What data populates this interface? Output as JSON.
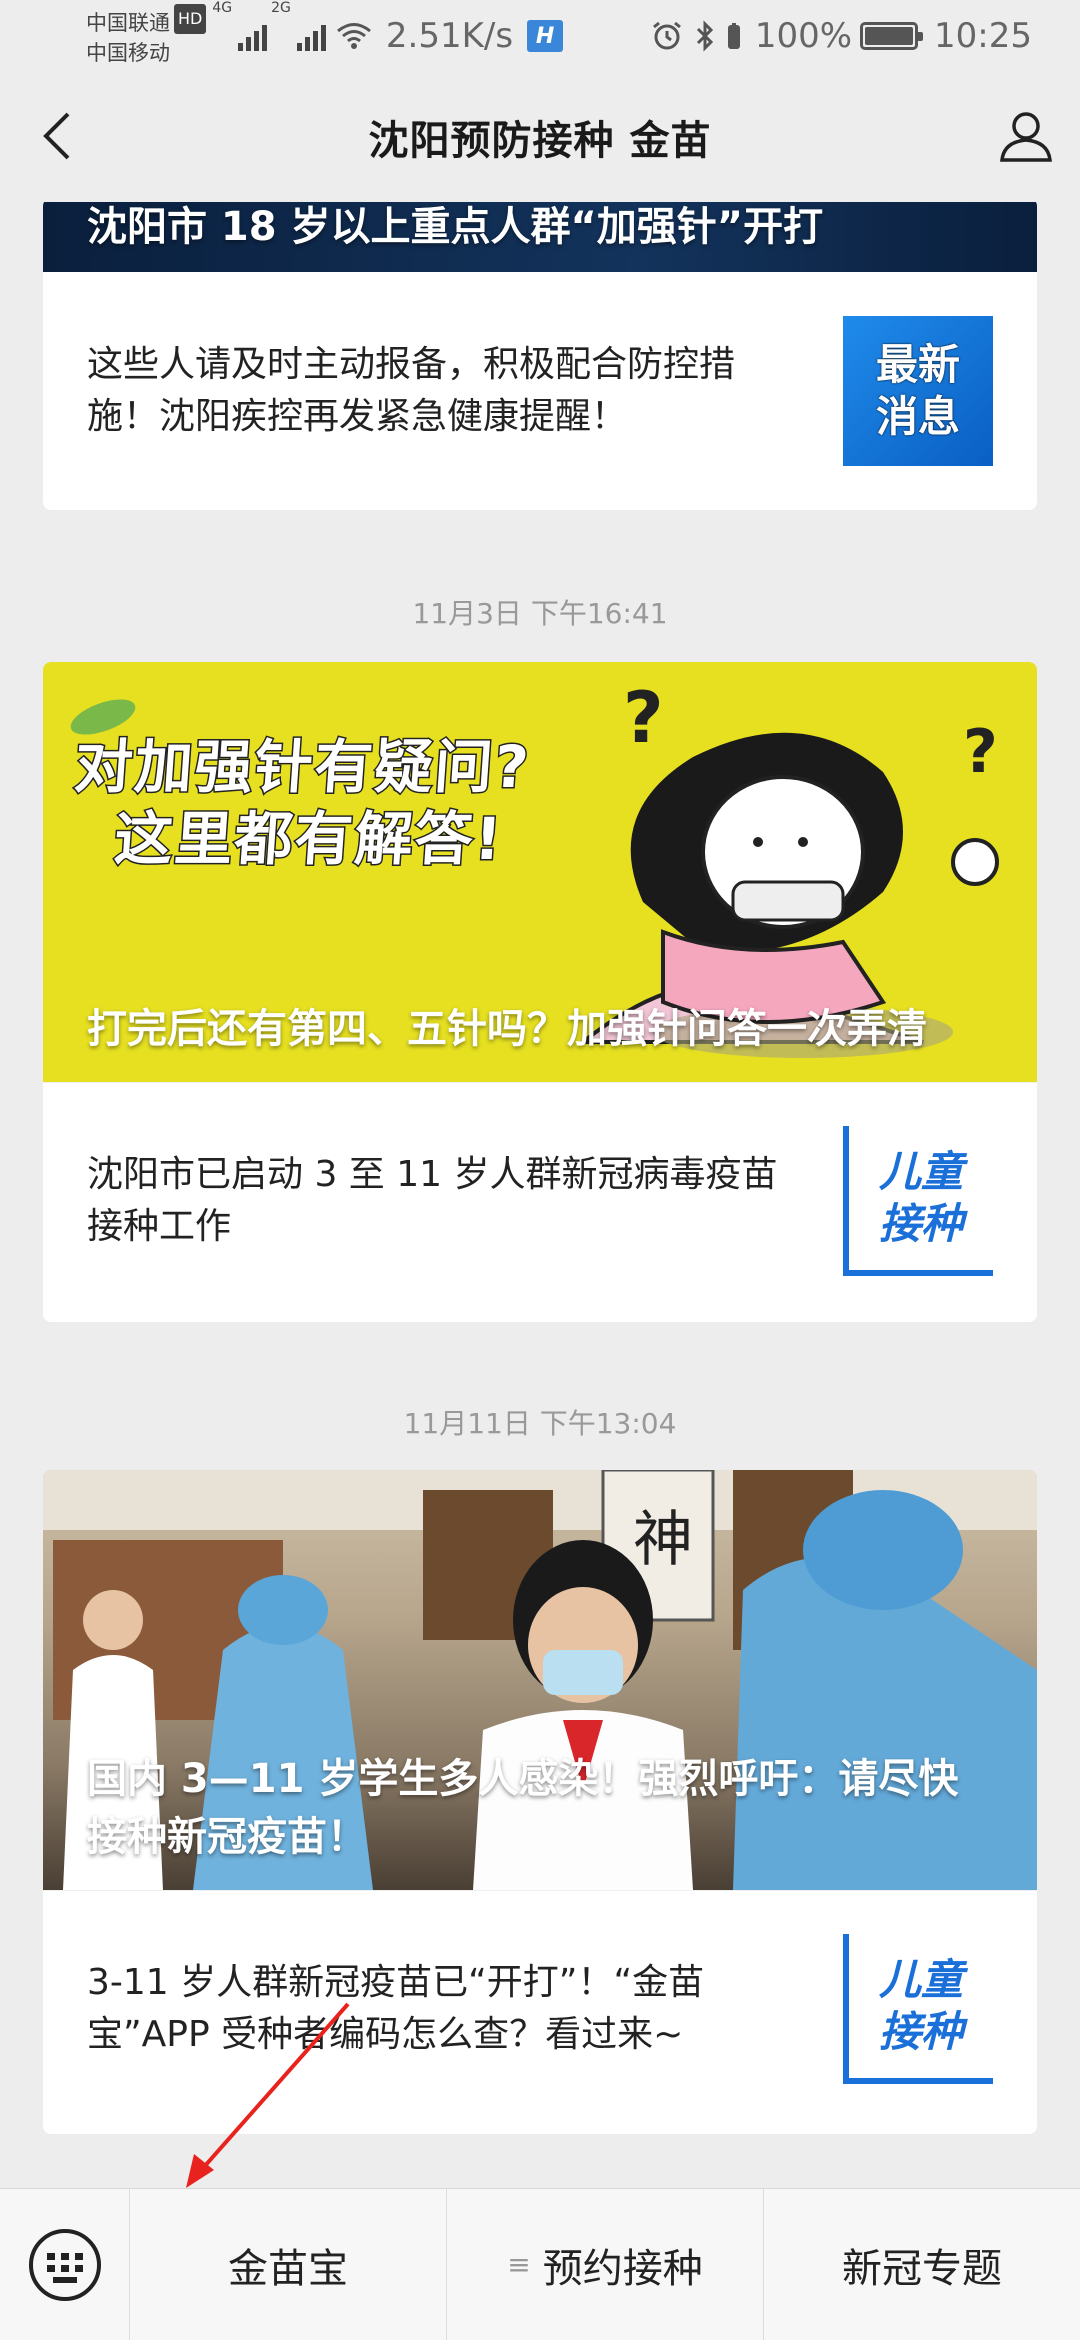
{
  "status_bar": {
    "carrier1": "中国联通",
    "carrier2": "中国移动",
    "hd": "HD",
    "net1": "4G",
    "net2": "2G",
    "speed": "2.51K/s",
    "hicon": "H",
    "battery": "100%",
    "time": "10:25"
  },
  "nav": {
    "title": "沈阳预防接种 金苗"
  },
  "feed": {
    "card1": {
      "hero_title": "沈阳市 18 岁以上重点人群“加强针”开打",
      "item_text": "这些人请及时主动报备，积极配合防控措施！沈阳疾控再发紧急健康提醒！",
      "thumb_line1": "最新",
      "thumb_line2": "消息"
    },
    "timestamp1": "11月3日 下午16:41",
    "card2": {
      "banner_line1": "对加强针有疑问?",
      "banner_line2": "这里都有解答!",
      "hero_title": "打完后还有第四、五针吗？加强针问答一次弄清",
      "item_text": "沈阳市已启动 3 至 11 岁人群新冠病毒疫苗接种工作",
      "thumb_line1": "儿童",
      "thumb_line2": "接种"
    },
    "timestamp2": "11月11日 下午13:04",
    "card3": {
      "photo_sign": "神",
      "hero_title": "国内 3—11 岁学生多人感染！强烈呼吁：请尽快接种新冠疫苗！",
      "item_text": "3-11 岁人群新冠疫苗已“开打”！“金苗宝”APP 受种者编码怎么查？看过来~",
      "thumb_line1": "儿童",
      "thumb_line2": "接种"
    }
  },
  "bottom_menu": {
    "items": [
      "金苗宝",
      "预约接种",
      "新冠专题"
    ],
    "hamb": "≡"
  }
}
